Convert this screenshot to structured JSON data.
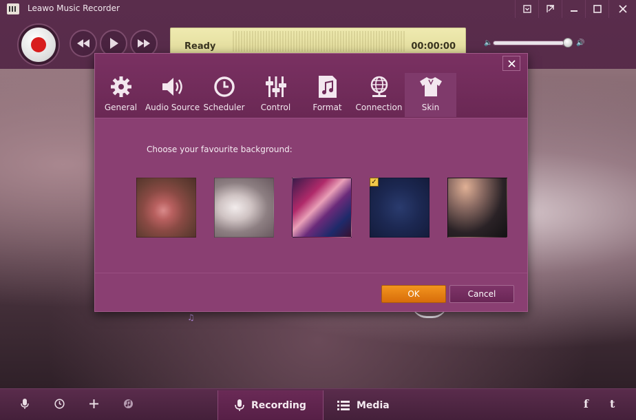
{
  "window": {
    "title": "Leawo Music Recorder",
    "buttons": [
      "menu-icon",
      "minimize-to-tray-icon",
      "minimize-icon",
      "maximize-icon",
      "close-icon"
    ]
  },
  "player": {
    "status": "Ready",
    "time": "00:00:00",
    "volume_fraction": 0.9
  },
  "dialog": {
    "tabs": [
      {
        "label": "General",
        "icon": "gear-icon"
      },
      {
        "label": "Audio Source",
        "icon": "speaker-icon"
      },
      {
        "label": "Scheduler",
        "icon": "clock-icon"
      },
      {
        "label": "Control",
        "icon": "sliders-icon"
      },
      {
        "label": "Format",
        "icon": "music-file-icon"
      },
      {
        "label": "Connection",
        "icon": "globe-icon"
      },
      {
        "label": "Skin",
        "icon": "shirt-icon"
      }
    ],
    "active_tab": "Skin",
    "prompt": "Choose your favourite background:",
    "selected_background": 4,
    "ok_label": "OK",
    "cancel_label": "Cancel"
  },
  "bottom": {
    "tabs": [
      {
        "label": "Recording",
        "icon": "microphone-icon"
      },
      {
        "label": "Media",
        "icon": "list-icon"
      }
    ],
    "active_tab": "Recording",
    "left_icons": [
      "microphone-icon",
      "clock-icon",
      "plus-icon",
      "music-search-icon"
    ],
    "social": {
      "facebook": "f",
      "twitter": "t"
    }
  },
  "colors": {
    "dialog_bg": "#8a3f72",
    "accent_ok": "#e67e12",
    "record_red": "#d81d1d"
  }
}
